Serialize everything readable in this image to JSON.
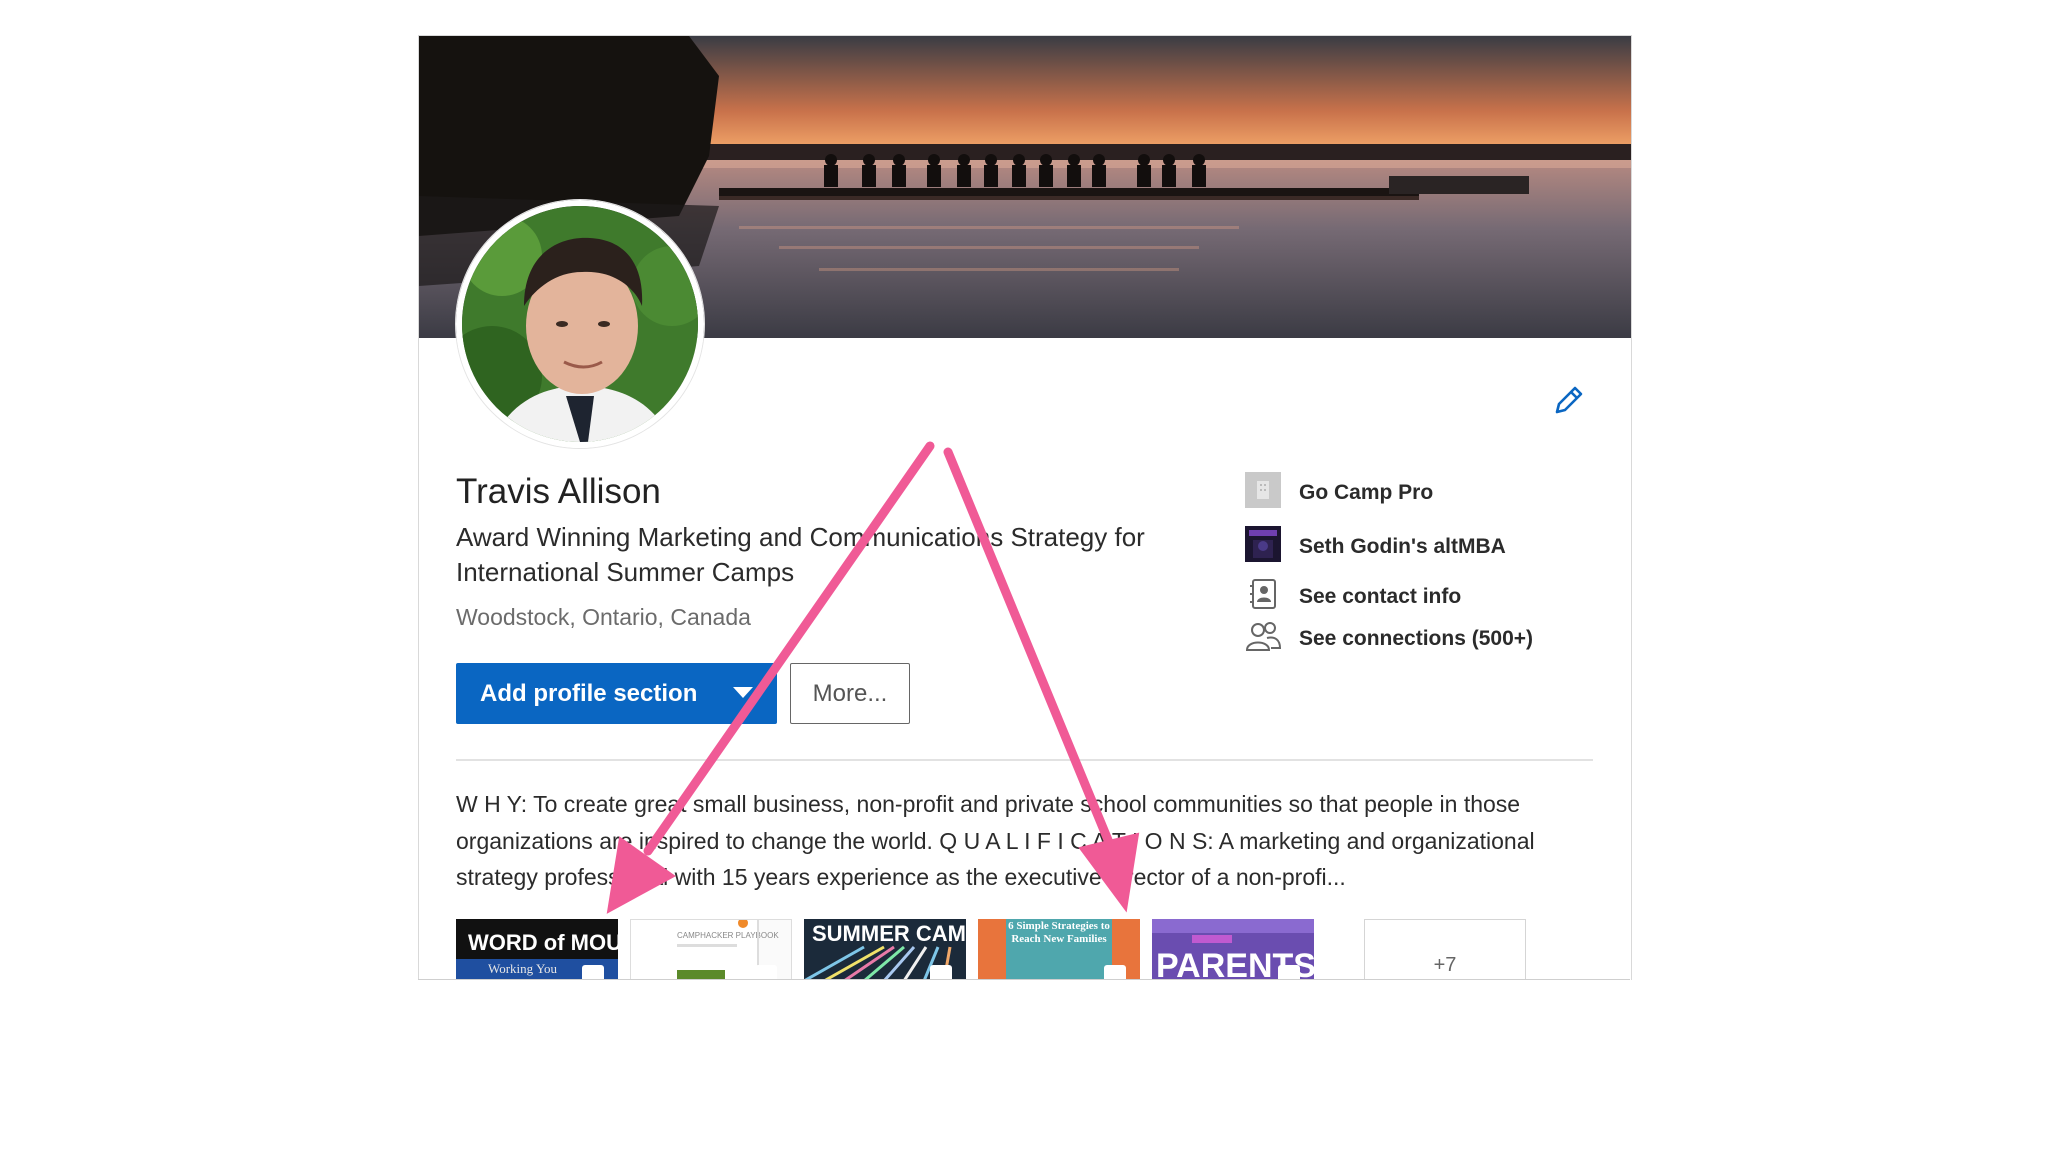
{
  "profile": {
    "name": "Travis Allison",
    "headline": "Award Winning Marketing and Communications Strategy for International Summer Camps",
    "location": "Woodstock, Ontario, Canada"
  },
  "actions": {
    "add_section_label": "Add profile section",
    "more_label": "More..."
  },
  "sidebar": {
    "items": [
      {
        "label": "Go Camp Pro",
        "icon": "company-icon"
      },
      {
        "label": "Seth Godin's altMBA",
        "icon": "school-logo-icon"
      },
      {
        "label": "See contact info",
        "icon": "contact-card-icon"
      },
      {
        "label": "See connections (500+)",
        "icon": "people-icon"
      }
    ]
  },
  "summary": {
    "text": "W H Y: To create great small business, non-profit and private school communities so that people in those organizations are inspired to change the world. Q U A L I F I C A T I O N S: A marketing and organizational strategy professional with 15 years experience as the executive director of a non-profi..."
  },
  "media": {
    "thumbs": [
      {
        "title": "WORD of MOUTH",
        "subtitle": "Working You"
      },
      {
        "title": "CAMPHACKER PLAYBOOK",
        "subtitle": ""
      },
      {
        "title": "SUMMER CAMP",
        "subtitle": ""
      },
      {
        "title": "6 Simple Strategies to Reach New Families",
        "subtitle": ""
      },
      {
        "title": "PARENTS",
        "subtitle": ""
      }
    ],
    "more_count": "+7"
  },
  "colors": {
    "primary": "#0a66c2",
    "annotation_arrow": "#f05a96"
  }
}
